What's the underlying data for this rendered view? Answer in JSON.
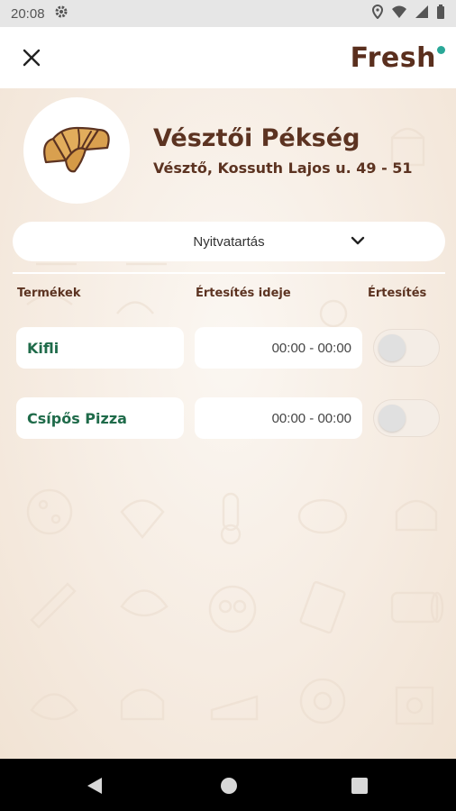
{
  "status_bar": {
    "time": "20:08",
    "icons": [
      "gear-icon",
      "location-icon",
      "wifi-icon",
      "signal-icon",
      "battery-icon"
    ]
  },
  "app_bar": {
    "close_icon": "close-icon",
    "logo_text": "Fresh",
    "logo_dot_color": "#2aa898"
  },
  "shop": {
    "name": "Vésztői Pékség",
    "address": "Vésztő, Kossuth Lajos u. 49 - 51",
    "avatar_icon": "croissant-icon"
  },
  "hours_dropdown": {
    "label": "Nyitvatartás",
    "icon": "chevron-down-icon"
  },
  "table": {
    "headers": {
      "products": "Termékek",
      "notify_time": "Értesítés ideje",
      "notify": "Értesítés"
    },
    "rows": [
      {
        "name": "Kifli",
        "time": "00:00 - 00:00",
        "notify_enabled": false
      },
      {
        "name": "Csípős Pizza",
        "time": "00:00 - 00:00",
        "notify_enabled": false
      }
    ]
  },
  "nav_bar": {
    "back_icon": "back-triangle-icon",
    "home_icon": "home-circle-icon",
    "recents_icon": "recents-square-icon"
  },
  "colors": {
    "brand_brown": "#5c3321",
    "product_green": "#1f6b4a",
    "background": "#f5ebe0"
  }
}
